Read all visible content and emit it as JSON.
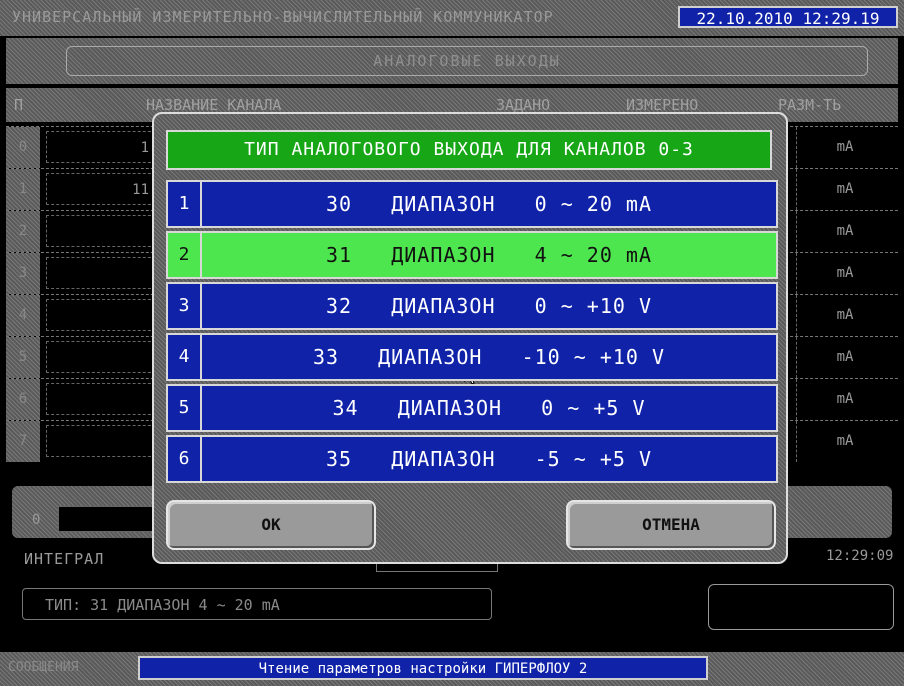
{
  "app_title": "УНИВЕРСАЛЬНЫЙ ИЗМЕРИТЕЛЬНО-ВЫЧИСЛИТЕЛЬНЫЙ КОММУНИКАТОР",
  "datetime": "22.10.2010 12:29.19",
  "screen_title": "АНАЛОГОВЫЕ ВЫХОДЫ",
  "table": {
    "headers": {
      "index": "П",
      "name": "НАЗВАНИЕ КАНАЛА",
      "set": "ЗАДАНО",
      "measured": "ИЗМЕРЕНО",
      "unit": "РАЗМ-ТЬ"
    },
    "rows": [
      {
        "idx": "0",
        "name": "1",
        "unit": "mA"
      },
      {
        "idx": "1",
        "name": "11",
        "unit": "mA"
      },
      {
        "idx": "2",
        "name": "",
        "unit": "mA"
      },
      {
        "idx": "3",
        "name": "",
        "unit": "mA"
      },
      {
        "idx": "4",
        "name": "",
        "unit": "mA"
      },
      {
        "idx": "5",
        "name": "",
        "unit": "mA"
      },
      {
        "idx": "6",
        "name": "",
        "unit": "mA"
      },
      {
        "idx": "7",
        "name": "",
        "unit": "mA"
      }
    ]
  },
  "lower": {
    "index": "0",
    "integral_label": "ИНТЕГРАЛ",
    "time": "12:29:09",
    "type_text": "ТИП:  31   ДИАПАЗОН   4 ~ 20 mA"
  },
  "status": {
    "label": "СООБЩЕНИЯ",
    "message": "Чтение параметров настройки ГИПЕРФЛОУ 2"
  },
  "dialog": {
    "title": "ТИП АНАЛОГОВОГО ВЫХОДА ДЛЯ КАНАЛОВ 0-3",
    "options": [
      {
        "num": "1",
        "label": "30   ДИАПАЗОН   0 ~ 20 mA"
      },
      {
        "num": "2",
        "label": "31   ДИАПАЗОН   4 ~ 20 mA"
      },
      {
        "num": "3",
        "label": "32   ДИАПАЗОН   0 ~ +10 V"
      },
      {
        "num": "4",
        "label": "33   ДИАПАЗОН   -10 ~ +10 V"
      },
      {
        "num": "5",
        "label": "34   ДИАПАЗОН   0 ~ +5 V"
      },
      {
        "num": "6",
        "label": "35   ДИАПАЗОН   -5 ~ +5 V"
      }
    ],
    "selected": "2",
    "ok_label": "OK",
    "cancel_label": "ОТМЕНА"
  },
  "colors": {
    "dialog_title_bg": "#16a616",
    "option_bg": "#0f22a8",
    "option_selected_bg": "#4ee64e",
    "button_bg": "#9a9a9a"
  }
}
